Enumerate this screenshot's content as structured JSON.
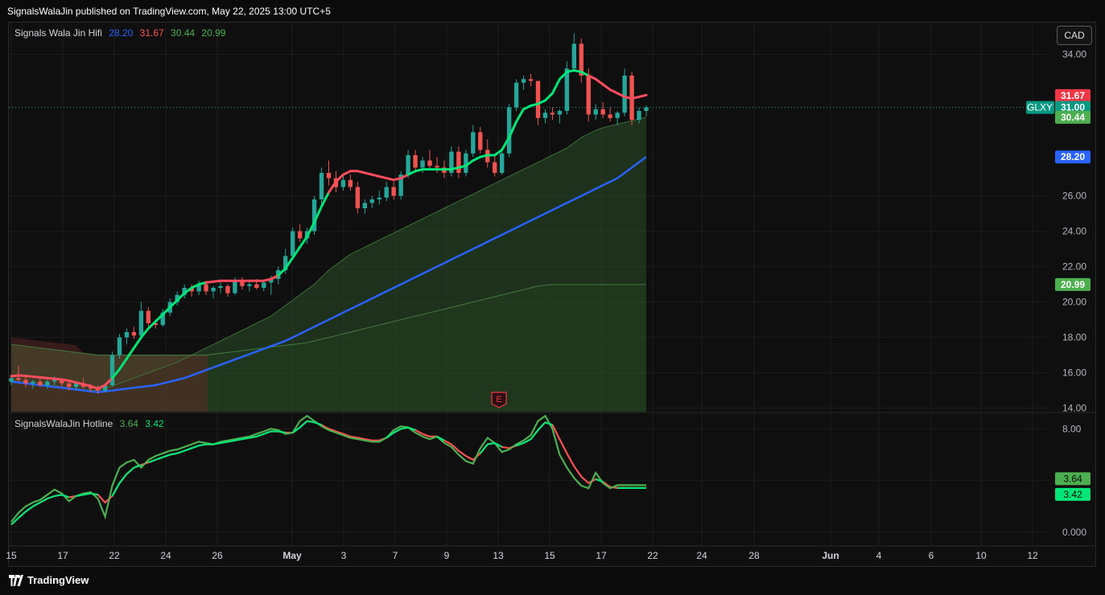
{
  "header": {
    "published": "SignalsWalaJin published on TradingView.com, May 22, 2025 13:00 UTC+5"
  },
  "brand": {
    "name": "TradingView",
    "icon": "tradingview-logo-icon"
  },
  "currency_button": "CAD",
  "colors": {
    "up": "#26a69a",
    "down": "#ef5350",
    "trend_up": "#00e676",
    "trend_down": "#ff4d5e",
    "ma_blue": "#2962ff",
    "band_green": "#4caf50",
    "osc_green": "#4caf50",
    "osc_red": "#ff5252"
  },
  "chart_data": [
    {
      "type": "candlestick",
      "title": "Signals Wala Jin Hifi",
      "symbol": "GLXY",
      "last_price": 31.0,
      "legend_values": [
        "28.20",
        "31.67",
        "30.44",
        "20.99"
      ],
      "ylim": [
        13.8,
        35.8
      ],
      "yticks": [
        "34.00",
        "26.00",
        "24.00",
        "22.00",
        "20.00",
        "18.00",
        "16.00",
        "14.00"
      ],
      "xticks": [
        "15",
        "17",
        "22",
        "24",
        "26",
        "May",
        "3",
        "7",
        "9",
        "13",
        "15",
        "17",
        "22",
        "24",
        "28",
        "Jun",
        "4",
        "6",
        "10",
        "12"
      ],
      "price_labels": [
        {
          "text": "31.67",
          "value": 31.67,
          "color": "#f23645"
        },
        {
          "text": "31.00",
          "value": 31.0,
          "color": "#089981",
          "tag": "GLXY"
        },
        {
          "text": "30.44",
          "value": 30.44,
          "color": "#4caf50"
        },
        {
          "text": "28.20",
          "value": 28.2,
          "color": "#2962ff"
        },
        {
          "text": "20.99",
          "value": 20.99,
          "color": "#4caf50"
        }
      ],
      "earnings_marker": "E",
      "candles": [
        [
          15.5,
          15.9,
          15.3,
          15.7
        ],
        [
          15.7,
          16.4,
          15.5,
          15.6
        ],
        [
          15.6,
          15.8,
          15.2,
          15.4
        ],
        [
          15.4,
          15.6,
          15.1,
          15.5
        ],
        [
          15.5,
          15.7,
          15.2,
          15.3
        ],
        [
          15.3,
          15.6,
          15.1,
          15.5
        ],
        [
          15.5,
          15.8,
          15.3,
          15.6
        ],
        [
          15.6,
          15.7,
          15.2,
          15.4
        ],
        [
          15.4,
          15.6,
          15.0,
          15.2
        ],
        [
          15.2,
          15.5,
          15.0,
          15.4
        ],
        [
          15.4,
          15.7,
          15.1,
          15.2
        ],
        [
          15.2,
          15.4,
          14.9,
          15.1
        ],
        [
          15.1,
          15.3,
          14.8,
          15.0
        ],
        [
          15.0,
          15.4,
          14.9,
          15.3
        ],
        [
          15.3,
          17.2,
          15.2,
          17.0
        ],
        [
          17.0,
          18.2,
          16.8,
          18.0
        ],
        [
          18.0,
          18.5,
          17.6,
          18.3
        ],
        [
          18.3,
          18.6,
          17.9,
          18.1
        ],
        [
          18.1,
          20.0,
          17.9,
          19.5
        ],
        [
          19.5,
          19.7,
          18.6,
          18.8
        ],
        [
          18.8,
          19.0,
          18.5,
          18.7
        ],
        [
          18.7,
          19.6,
          18.6,
          19.4
        ],
        [
          19.4,
          20.2,
          19.2,
          20.0
        ],
        [
          20.0,
          20.6,
          19.8,
          20.4
        ],
        [
          20.4,
          21.0,
          20.2,
          20.8
        ],
        [
          20.8,
          21.0,
          20.3,
          20.6
        ],
        [
          20.6,
          21.2,
          20.4,
          21.0
        ],
        [
          21.0,
          21.2,
          20.4,
          20.6
        ],
        [
          20.6,
          20.9,
          20.2,
          20.8
        ],
        [
          20.8,
          21.1,
          20.5,
          20.9
        ],
        [
          20.9,
          21.0,
          20.3,
          20.5
        ],
        [
          20.5,
          21.4,
          20.4,
          21.2
        ],
        [
          21.2,
          21.4,
          20.7,
          20.9
        ],
        [
          20.9,
          21.2,
          20.6,
          21.0
        ],
        [
          21.0,
          21.3,
          20.7,
          20.8
        ],
        [
          20.8,
          21.2,
          20.6,
          21.1
        ],
        [
          21.1,
          21.5,
          20.4,
          21.3
        ],
        [
          21.3,
          22.0,
          21.0,
          21.8
        ],
        [
          21.8,
          23.0,
          21.6,
          22.6
        ],
        [
          22.6,
          24.2,
          22.4,
          24.0
        ],
        [
          24.0,
          24.4,
          23.4,
          23.6
        ],
        [
          23.6,
          24.2,
          23.3,
          24.0
        ],
        [
          24.0,
          26.0,
          23.8,
          25.8
        ],
        [
          25.8,
          27.6,
          25.5,
          27.3
        ],
        [
          27.3,
          28.0,
          26.6,
          27.0
        ],
        [
          27.0,
          27.4,
          26.2,
          26.5
        ],
        [
          26.5,
          27.2,
          26.3,
          26.9
        ],
        [
          26.9,
          27.2,
          26.3,
          26.5
        ],
        [
          26.5,
          26.8,
          25.0,
          25.3
        ],
        [
          25.3,
          25.8,
          25.0,
          25.6
        ],
        [
          25.6,
          26.0,
          25.3,
          25.8
        ],
        [
          25.8,
          26.3,
          25.5,
          25.9
        ],
        [
          25.9,
          26.8,
          25.7,
          26.5
        ],
        [
          26.5,
          26.8,
          25.8,
          26.0
        ],
        [
          26.0,
          27.4,
          25.8,
          27.2
        ],
        [
          27.2,
          28.6,
          27.0,
          28.3
        ],
        [
          28.3,
          28.6,
          27.3,
          27.6
        ],
        [
          27.6,
          28.2,
          27.3,
          28.0
        ],
        [
          28.0,
          28.6,
          27.5,
          27.7
        ],
        [
          27.7,
          28.2,
          27.3,
          27.6
        ],
        [
          27.6,
          28.0,
          27.0,
          27.3
        ],
        [
          27.3,
          28.8,
          27.1,
          28.5
        ],
        [
          28.5,
          28.8,
          27.0,
          27.3
        ],
        [
          27.3,
          28.6,
          27.1,
          28.4
        ],
        [
          28.4,
          30.0,
          28.2,
          29.6
        ],
        [
          29.6,
          29.9,
          28.4,
          28.6
        ],
        [
          28.6,
          29.2,
          27.6,
          27.9
        ],
        [
          27.9,
          28.4,
          27.1,
          27.3
        ],
        [
          27.3,
          28.6,
          27.2,
          28.4
        ],
        [
          28.4,
          31.2,
          28.2,
          31.0
        ],
        [
          31.0,
          32.6,
          30.8,
          32.4
        ],
        [
          32.4,
          32.8,
          32.0,
          32.6
        ],
        [
          32.6,
          32.9,
          32.2,
          32.5
        ],
        [
          32.5,
          31.0,
          30.0,
          30.4
        ],
        [
          30.4,
          30.9,
          30.1,
          30.7
        ],
        [
          30.7,
          31.0,
          30.3,
          30.6
        ],
        [
          30.6,
          30.9,
          30.1,
          30.8
        ],
        [
          30.8,
          33.6,
          30.6,
          33.2
        ],
        [
          33.2,
          35.2,
          33.0,
          34.6
        ],
        [
          34.6,
          34.9,
          32.4,
          32.8
        ],
        [
          32.8,
          33.2,
          30.2,
          30.6
        ],
        [
          30.6,
          31.2,
          30.3,
          30.9
        ],
        [
          30.9,
          31.3,
          30.4,
          30.6
        ],
        [
          30.6,
          31.0,
          30.2,
          30.4
        ],
        [
          30.4,
          30.8,
          30.0,
          30.7
        ],
        [
          30.7,
          33.2,
          30.5,
          32.8
        ],
        [
          32.8,
          33.0,
          30.0,
          30.3
        ],
        [
          30.3,
          31.0,
          30.1,
          30.8
        ],
        [
          30.8,
          31.1,
          30.5,
          31.0
        ]
      ],
      "supertrend": [
        15.8,
        15.85,
        15.82,
        15.78,
        15.74,
        15.7,
        15.66,
        15.62,
        15.55,
        15.45,
        15.35,
        15.25,
        15.1,
        15.3,
        15.7,
        16.2,
        16.8,
        17.4,
        18.0,
        18.5,
        18.9,
        19.3,
        19.7,
        20.1,
        20.5,
        20.8,
        21.0,
        21.1,
        21.15,
        21.2,
        21.2,
        21.2,
        21.2,
        21.2,
        21.2,
        21.2,
        21.3,
        21.5,
        21.9,
        22.5,
        23.1,
        23.7,
        24.5,
        25.4,
        26.2,
        26.8,
        27.2,
        27.4,
        27.4,
        27.3,
        27.2,
        27.1,
        27.0,
        26.9,
        27.0,
        27.2,
        27.4,
        27.5,
        27.5,
        27.5,
        27.5,
        27.5,
        27.6,
        27.7,
        28.0,
        28.2,
        28.3,
        28.3,
        28.6,
        29.3,
        30.2,
        30.9,
        31.1,
        31.2,
        31.4,
        31.8,
        32.6,
        33.0,
        33.1,
        33.0,
        32.8,
        32.6,
        32.3,
        32.0,
        31.8,
        31.6,
        31.5,
        31.6,
        31.7
      ],
      "supertrend_bear_ranges": [
        [
          0,
          13
        ],
        [
          27,
          36
        ],
        [
          44,
          54
        ],
        [
          80,
          89
        ]
      ],
      "band_upper": [
        15.6,
        15.5,
        15.45,
        15.4,
        15.35,
        15.3,
        15.25,
        15.2,
        15.15,
        15.1,
        15.05,
        15.0,
        15.0,
        15.1,
        15.25,
        15.4,
        15.55,
        15.7,
        15.85,
        16.0,
        16.15,
        16.3,
        16.45,
        16.6,
        16.8,
        17.0,
        17.2,
        17.4,
        17.6,
        17.8,
        18.0,
        18.2,
        18.4,
        18.6,
        18.8,
        19.0,
        19.2,
        19.5,
        19.8,
        20.1,
        20.4,
        20.7,
        21.0,
        21.4,
        21.8,
        22.1,
        22.4,
        22.7,
        22.9,
        23.1,
        23.3,
        23.5,
        23.7,
        23.9,
        24.1,
        24.3,
        24.5,
        24.7,
        24.9,
        25.1,
        25.3,
        25.5,
        25.7,
        25.9,
        26.1,
        26.3,
        26.5,
        26.7,
        26.9,
        27.1,
        27.3,
        27.5,
        27.7,
        27.9,
        28.1,
        28.3,
        28.5,
        28.7,
        29.0,
        29.3,
        29.5,
        29.7,
        29.85,
        29.95,
        30.05,
        30.15,
        30.25,
        30.35,
        30.44
      ],
      "ma_blue": [
        15.5,
        15.45,
        15.4,
        15.35,
        15.3,
        15.25,
        15.2,
        15.15,
        15.1,
        15.05,
        15.0,
        14.95,
        14.9,
        14.95,
        15.0,
        15.05,
        15.1,
        15.15,
        15.2,
        15.25,
        15.3,
        15.4,
        15.5,
        15.6,
        15.7,
        15.85,
        16.0,
        16.15,
        16.3,
        16.45,
        16.6,
        16.75,
        16.9,
        17.05,
        17.2,
        17.35,
        17.5,
        17.65,
        17.8,
        18.0,
        18.2,
        18.4,
        18.6,
        18.8,
        19.0,
        19.2,
        19.4,
        19.6,
        19.8,
        20.0,
        20.2,
        20.4,
        20.6,
        20.8,
        21.0,
        21.2,
        21.4,
        21.6,
        21.8,
        22.0,
        22.2,
        22.4,
        22.6,
        22.8,
        23.0,
        23.2,
        23.4,
        23.6,
        23.8,
        24.0,
        24.2,
        24.4,
        24.6,
        24.8,
        25.0,
        25.2,
        25.4,
        25.6,
        25.8,
        26.0,
        26.2,
        26.4,
        26.6,
        26.8,
        27.0,
        27.3,
        27.6,
        27.9,
        28.2
      ],
      "band_lower": [
        17.6,
        17.55,
        17.5,
        17.45,
        17.4,
        17.35,
        17.3,
        17.25,
        17.2,
        17.15,
        17.1,
        17.05,
        17.0,
        17.0,
        17.0,
        17.0,
        17.0,
        17.0,
        17.0,
        17.0,
        17.0,
        17.0,
        17.0,
        17.0,
        17.0,
        17.0,
        17.0,
        17.0,
        17.05,
        17.1,
        17.15,
        17.2,
        17.25,
        17.3,
        17.35,
        17.4,
        17.45,
        17.5,
        17.55,
        17.6,
        17.65,
        17.7,
        17.8,
        17.9,
        18.0,
        18.1,
        18.2,
        18.3,
        18.4,
        18.5,
        18.6,
        18.7,
        18.8,
        18.9,
        19.0,
        19.1,
        19.2,
        19.3,
        19.4,
        19.5,
        19.6,
        19.7,
        19.8,
        19.9,
        20.0,
        20.1,
        20.2,
        20.3,
        20.4,
        20.5,
        20.6,
        20.7,
        20.8,
        20.9,
        20.95,
        20.99,
        20.99,
        20.99,
        20.99,
        20.99,
        20.99,
        20.99,
        20.99,
        20.99,
        20.99,
        20.99,
        20.99,
        20.99,
        20.99
      ]
    },
    {
      "type": "line",
      "title": "SignalsWalaJin Hotline",
      "legend_values": [
        "3.64",
        "3.42"
      ],
      "ylim": [
        -1.0,
        9.2
      ],
      "yticks": [
        "8.00",
        "0.000"
      ],
      "value_labels": [
        {
          "text": "3.64",
          "value": 3.64,
          "color": "#4caf50"
        },
        {
          "text": "3.42",
          "value": 3.42,
          "color": "#00e676"
        }
      ],
      "series": [
        {
          "values": [
            0.8,
            1.5,
            2.0,
            2.3,
            2.5,
            2.9,
            3.3,
            3.0,
            2.4,
            2.8,
            3.0,
            3.1,
            2.6,
            1.2,
            3.6,
            5.0,
            5.4,
            5.6,
            5.0,
            5.6,
            5.9,
            6.1,
            6.3,
            6.4,
            6.6,
            6.8,
            7.0,
            6.9,
            6.8,
            7.0,
            7.1,
            7.2,
            7.3,
            7.4,
            7.6,
            7.8,
            8.0,
            7.9,
            7.6,
            7.7,
            8.6,
            9.0,
            8.6,
            8.2,
            7.9,
            7.7,
            7.5,
            7.3,
            7.2,
            7.1,
            7.0,
            7.0,
            7.3,
            7.9,
            8.2,
            8.1,
            7.7,
            7.4,
            7.2,
            7.4,
            6.9,
            6.6,
            6.0,
            5.5,
            5.3,
            6.5,
            7.3,
            6.9,
            6.2,
            6.4,
            6.8,
            7.1,
            7.5,
            8.6,
            9.0,
            8.0,
            6.0,
            5.0,
            4.2,
            3.6,
            3.4,
            4.6,
            3.8,
            3.4,
            3.64,
            3.64,
            3.64,
            3.64,
            3.64
          ]
        },
        {
          "values": [
            0.6,
            1.1,
            1.6,
            2.0,
            2.3,
            2.6,
            2.8,
            2.9,
            2.7,
            2.8,
            2.9,
            3.0,
            2.9,
            2.3,
            2.8,
            3.8,
            4.5,
            5.0,
            5.2,
            5.4,
            5.6,
            5.8,
            6.0,
            6.1,
            6.3,
            6.5,
            6.7,
            6.8,
            6.8,
            6.9,
            7.0,
            7.1,
            7.2,
            7.3,
            7.4,
            7.6,
            7.8,
            7.8,
            7.7,
            7.7,
            8.1,
            8.6,
            8.5,
            8.3,
            8.0,
            7.8,
            7.6,
            7.4,
            7.3,
            7.2,
            7.1,
            7.1,
            7.3,
            7.7,
            8.0,
            8.1,
            7.9,
            7.6,
            7.4,
            7.4,
            7.1,
            6.8,
            6.3,
            5.9,
            5.6,
            6.1,
            6.8,
            6.9,
            6.6,
            6.5,
            6.7,
            6.9,
            7.2,
            7.9,
            8.5,
            8.3,
            7.2,
            6.1,
            5.1,
            4.3,
            3.8,
            4.1,
            3.9,
            3.5,
            3.42,
            3.42,
            3.42,
            3.42,
            3.42
          ]
        }
      ]
    }
  ]
}
